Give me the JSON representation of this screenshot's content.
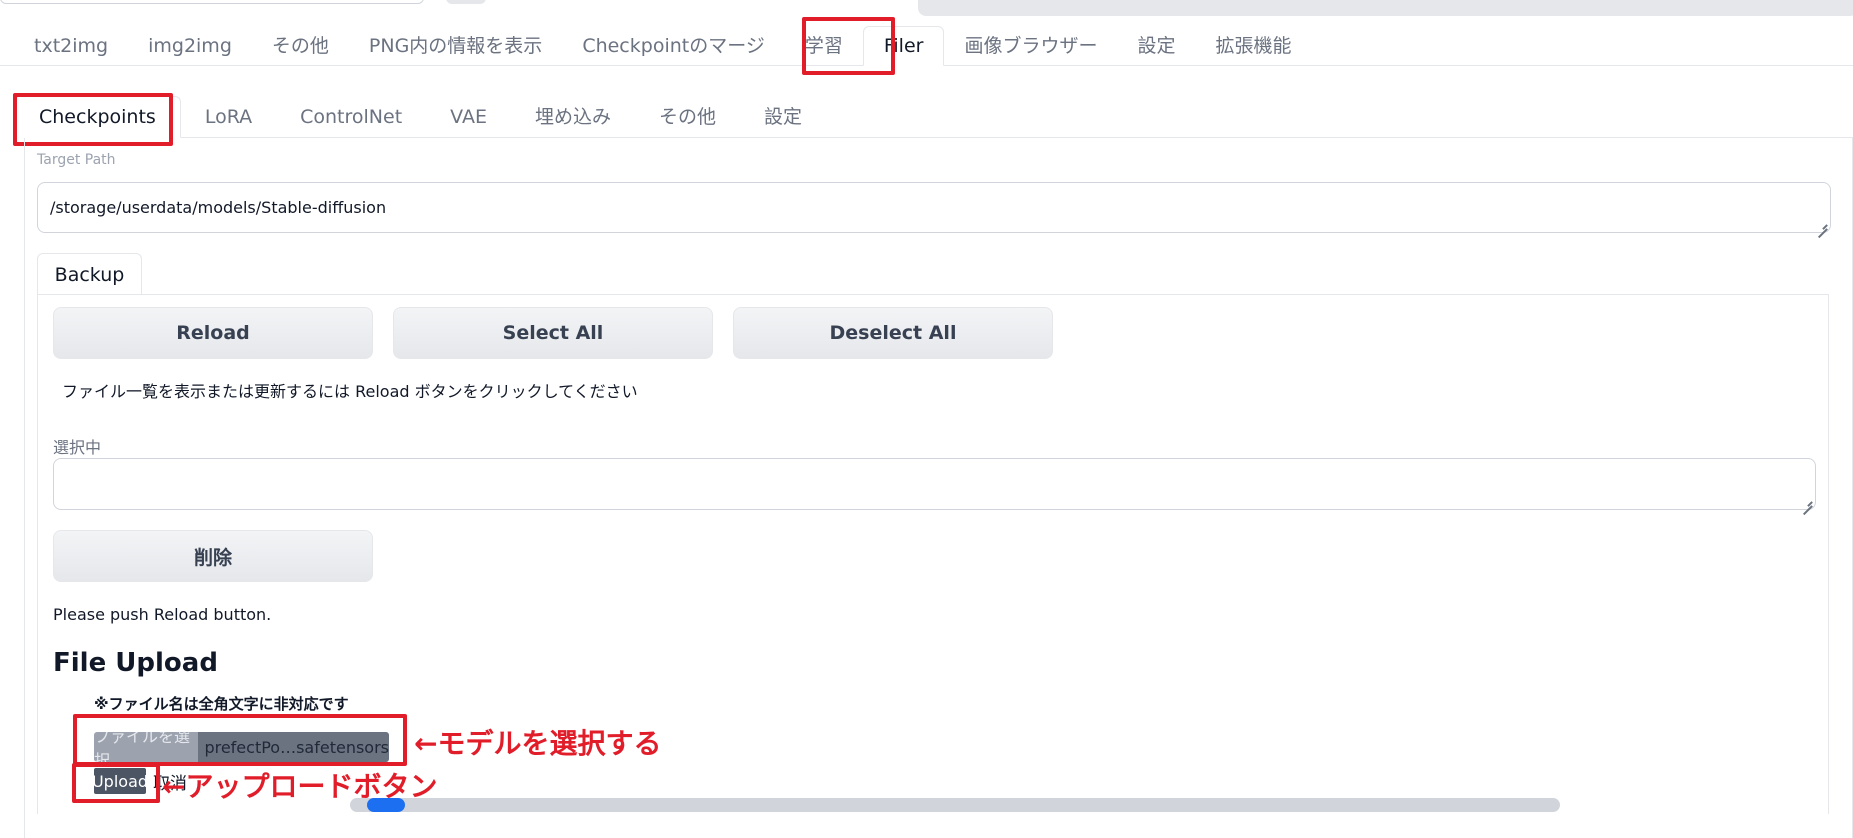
{
  "main_tabs": [
    {
      "label": "txt2img"
    },
    {
      "label": "img2img"
    },
    {
      "label": "その他"
    },
    {
      "label": "PNG内の情報を表示"
    },
    {
      "label": "Checkpointのマージ"
    },
    {
      "label": "学習"
    },
    {
      "label": "Filer",
      "active": true
    },
    {
      "label": "画像ブラウザー"
    },
    {
      "label": "設定"
    },
    {
      "label": "拡張機能"
    }
  ],
  "sub_tabs": [
    {
      "label": "Checkpoints",
      "active": true
    },
    {
      "label": "LoRA"
    },
    {
      "label": "ControlNet"
    },
    {
      "label": "VAE"
    },
    {
      "label": "埋め込み"
    },
    {
      "label": "その他"
    },
    {
      "label": "設定"
    }
  ],
  "target_path": {
    "label": "Target Path",
    "value": "/storage/userdata/models/Stable-diffusion"
  },
  "backup_tab": {
    "label": "Backup"
  },
  "buttons": {
    "reload": "Reload",
    "select_all": "Select All",
    "deselect_all": "Deselect All",
    "delete": "削除"
  },
  "reload_hint": "ファイル一覧を表示または更新するには Reload ボタンをクリックしてください",
  "selected": {
    "label": "選択中",
    "value": ""
  },
  "status_text": "Please push Reload button.",
  "file_upload": {
    "title": "File Upload",
    "note": "※ファイル名は全角文字に非対応です",
    "choose_label": "ファイルを選択",
    "file_name": "prefectPo…safetensors",
    "upload_label": "Upload",
    "cancel_label": "取消"
  },
  "annotations": {
    "select_model": "←モデルを選択する",
    "upload_button": "←アップロードボタン",
    "color": "#e11d2a"
  },
  "progress": {
    "fraction": 0.03
  }
}
